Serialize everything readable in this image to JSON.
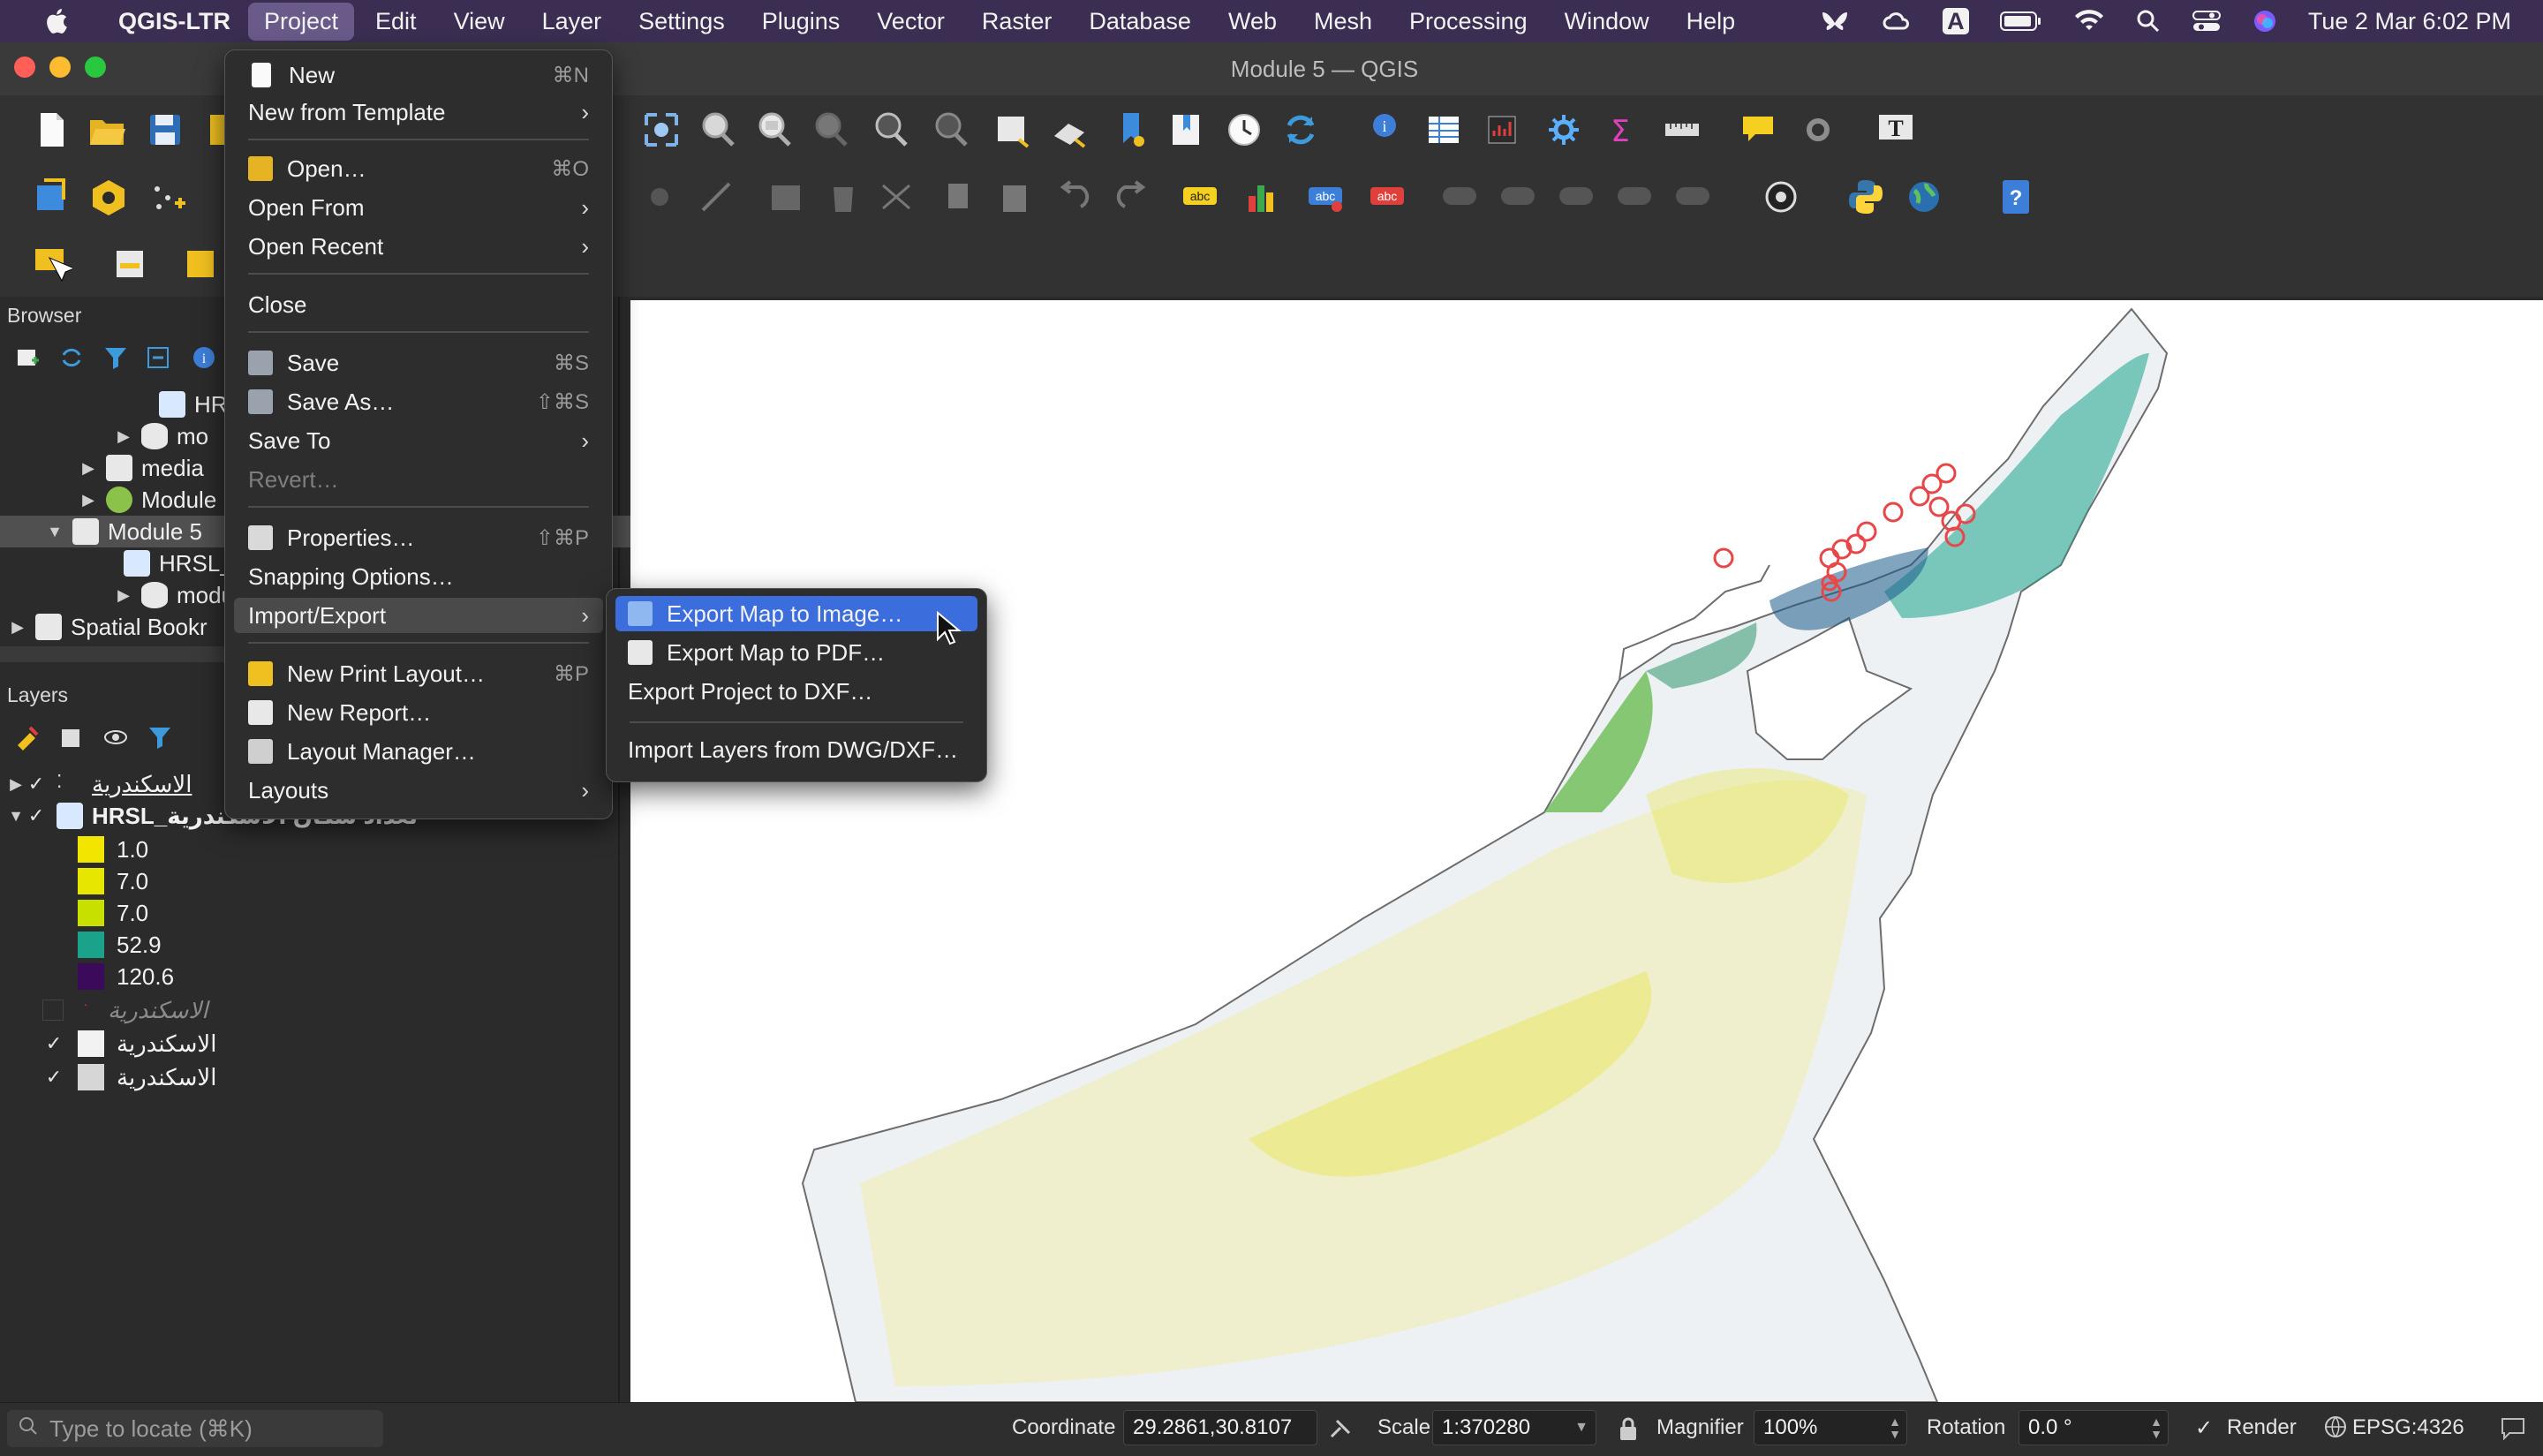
{
  "menubar": {
    "app_name": "QGIS-LTR",
    "items": [
      "Project",
      "Edit",
      "View",
      "Layer",
      "Settings",
      "Plugins",
      "Vector",
      "Raster",
      "Database",
      "Web",
      "Mesh",
      "Processing",
      "Window",
      "Help"
    ],
    "active_item": "Project",
    "clock": "Tue 2 Mar  6:02 PM",
    "input_source": "A"
  },
  "window": {
    "title": "Module 5 — QGIS"
  },
  "browser": {
    "title": "Browser",
    "rows": [
      {
        "label": "HRS",
        "icon": "raster-icon"
      },
      {
        "label": "mo",
        "icon": "database-icon"
      },
      {
        "label": "media",
        "icon": "folder-icon"
      },
      {
        "label": "Module",
        "icon": "qgis-project-icon"
      },
      {
        "label": "Module 5",
        "icon": "folder-icon"
      },
      {
        "label": "HRSL_",
        "icon": "raster-icon"
      },
      {
        "label": "modul",
        "icon": "database-icon"
      },
      {
        "label": "Spatial Bookr",
        "icon": "bookmark-icon"
      }
    ]
  },
  "layers": {
    "title": "Layers",
    "items": [
      {
        "label": "الاسكندرية",
        "checked": true
      },
      {
        "label": "HRSL_تعداد سكان الاسكندرية",
        "checked": true
      },
      {
        "label": "الاسكندرية",
        "checked": false
      },
      {
        "label": "الاسكندرية",
        "checked": true
      },
      {
        "label": "الاسكندرية",
        "checked": true
      }
    ],
    "legend": [
      {
        "value": "1.0",
        "color": "#f2e600"
      },
      {
        "value": "7.0",
        "color": "#e6e600"
      },
      {
        "value": "7.0",
        "color": "#c8e000"
      },
      {
        "value": "52.9",
        "color": "#1aa38a"
      },
      {
        "value": "120.6",
        "color": "#3c0a5a"
      }
    ]
  },
  "project_menu": {
    "items": [
      {
        "label": "New",
        "shortcut": "⌘N"
      },
      {
        "label": "New from Template",
        "submenu": true
      },
      {
        "label": "Open…",
        "shortcut": "⌘O"
      },
      {
        "label": "Open From",
        "submenu": true
      },
      {
        "label": "Open Recent",
        "submenu": true
      },
      {
        "label": "Close"
      },
      {
        "label": "Save",
        "shortcut": "⌘S"
      },
      {
        "label": "Save As…",
        "shortcut": "⇧⌘S"
      },
      {
        "label": "Save To",
        "submenu": true
      },
      {
        "label": "Revert…",
        "disabled": true
      },
      {
        "label": "Properties…",
        "shortcut": "⇧⌘P"
      },
      {
        "label": "Snapping Options…"
      },
      {
        "label": "Import/Export",
        "submenu": true
      },
      {
        "label": "New Print Layout…",
        "shortcut": "⌘P"
      },
      {
        "label": "New Report…"
      },
      {
        "label": "Layout Manager…"
      },
      {
        "label": "Layouts",
        "submenu": true
      }
    ]
  },
  "import_export_menu": {
    "items": [
      {
        "label": "Export Map to Image…"
      },
      {
        "label": "Export Map to PDF…"
      },
      {
        "label": "Export Project to DXF…"
      },
      {
        "label": "Import Layers from DWG/DXF…"
      }
    ]
  },
  "statusbar": {
    "locate_placeholder": "Type to locate (⌘K)",
    "coordinate_label": "Coordinate",
    "coordinate_value": "29.2861,30.8107",
    "scale_label": "Scale",
    "scale_value": "1:370280",
    "magnifier_label": "Magnifier",
    "magnifier_value": "100%",
    "rotation_label": "Rotation",
    "rotation_value": "0.0 °",
    "render_label": "Render",
    "render_checked": true,
    "crs": "EPSG:4326"
  },
  "colors": {
    "menubar_bg": "#3b2e52",
    "highlight": "#3b6ddc",
    "map_fill": "#eef1f3",
    "point_red": "#e8474a"
  }
}
